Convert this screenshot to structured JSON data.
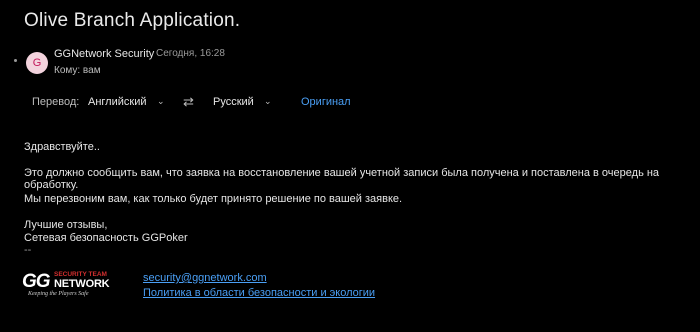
{
  "email": {
    "subject": "Olive Branch Application.",
    "avatar_letter": "G",
    "sender": "GGNetwork Security",
    "date": "Сегодня, 16:28",
    "to_label": "Кому: вам"
  },
  "translation": {
    "label": "Перевод:",
    "from_lang": "Английский",
    "to_lang": "Русский",
    "original_link": "Оригинал"
  },
  "body": {
    "greeting": "Здравствуйте..",
    "paragraph1": "Это должно сообщить вам, что заявка на восстановление вашей учетной записи была получена и поставлена в очередь на обработку.",
    "paragraph2": "Мы перезвоним вам, как только будет принято решение по вашей заявке.",
    "closing": "Лучшие отзывы,",
    "signature_name": "Сетевая безопасность GGPoker",
    "signature_sep": "--"
  },
  "signature": {
    "logo_gg": "GG",
    "logo_team": "SECURITY TEAM",
    "logo_network": "NETWORK",
    "logo_tagline": "Keeping the Players Safe",
    "email_link": "security@ggnetwork.com",
    "policy_link": "Политика в области безопасности и экологии"
  },
  "colors": {
    "background": "#000000",
    "link": "#4a9ff5",
    "avatar_bg": "#f3d3dd",
    "logo_red": "#d32f2f"
  }
}
